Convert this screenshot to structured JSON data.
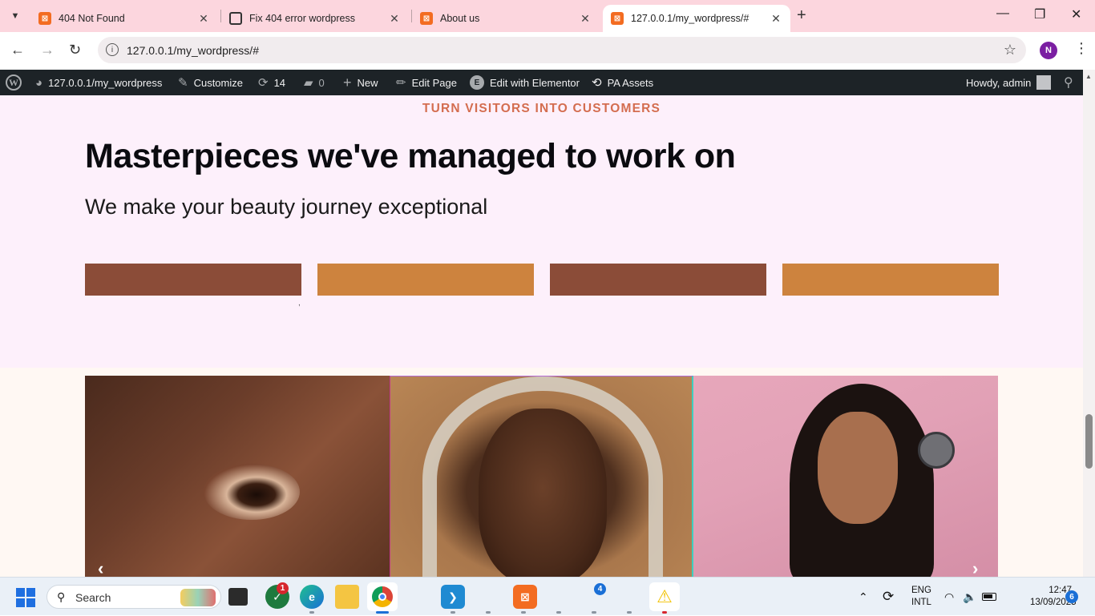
{
  "browser": {
    "tabs": [
      {
        "title": "404 Not Found",
        "favicon": "xampp-icon",
        "active": false
      },
      {
        "title": "Fix 404 error wordpress",
        "favicon": "chatgpt-icon",
        "active": false
      },
      {
        "title": "About us",
        "favicon": "xampp-icon",
        "active": false
      },
      {
        "title": "127.0.0.1/my_wordpress/#",
        "favicon": "xampp-icon",
        "active": true
      }
    ],
    "new_tab_glyph": "+",
    "url": "127.0.0.1/my_wordpress/#",
    "profile_initial": "N",
    "tab_strip_color": "#fcd6de"
  },
  "adminbar": {
    "site": "127.0.0.1/my_wordpress",
    "customize": "Customize",
    "updates_count": "14",
    "comments_count": "0",
    "new": "New",
    "edit_page": "Edit Page",
    "edit_elementor": "Edit with Elementor",
    "pa_assets": "PA Assets",
    "howdy": "Howdy, admin"
  },
  "page": {
    "eyebrow": "TURN VISITORS INTO CUSTOMERS",
    "headline": "Masterpieces we've managed to work on",
    "subhead": "We make your beauty journey exceptional",
    "swatches": [
      "#8b4c38",
      "#cd833e",
      "#8b4c38",
      "#cd833e"
    ],
    "accent_color": "#d46d4f",
    "gallery": [
      {
        "alt": "close-up eye photo"
      },
      {
        "alt": "bride with veil photo"
      },
      {
        "alt": "makeup application photo"
      }
    ],
    "prev_arrow": "‹",
    "next_arrow": "›"
  },
  "taskbar": {
    "search_placeholder": "Search",
    "apps": [
      {
        "name": "task-view-icon"
      },
      {
        "name": "app-with-badge-icon",
        "badge": "1"
      },
      {
        "name": "edge-icon"
      },
      {
        "name": "file-explorer-icon"
      },
      {
        "name": "chrome-icon"
      },
      {
        "name": "vscode-icon"
      },
      {
        "name": "xampp-icon"
      },
      {
        "name": "app-group-icon",
        "badge": "4"
      },
      {
        "name": "warning-app-icon"
      }
    ],
    "lang_line1": "ENG",
    "lang_line2": "INTL",
    "time": "12:47",
    "date": "13/09/2025",
    "notifications": "6"
  }
}
